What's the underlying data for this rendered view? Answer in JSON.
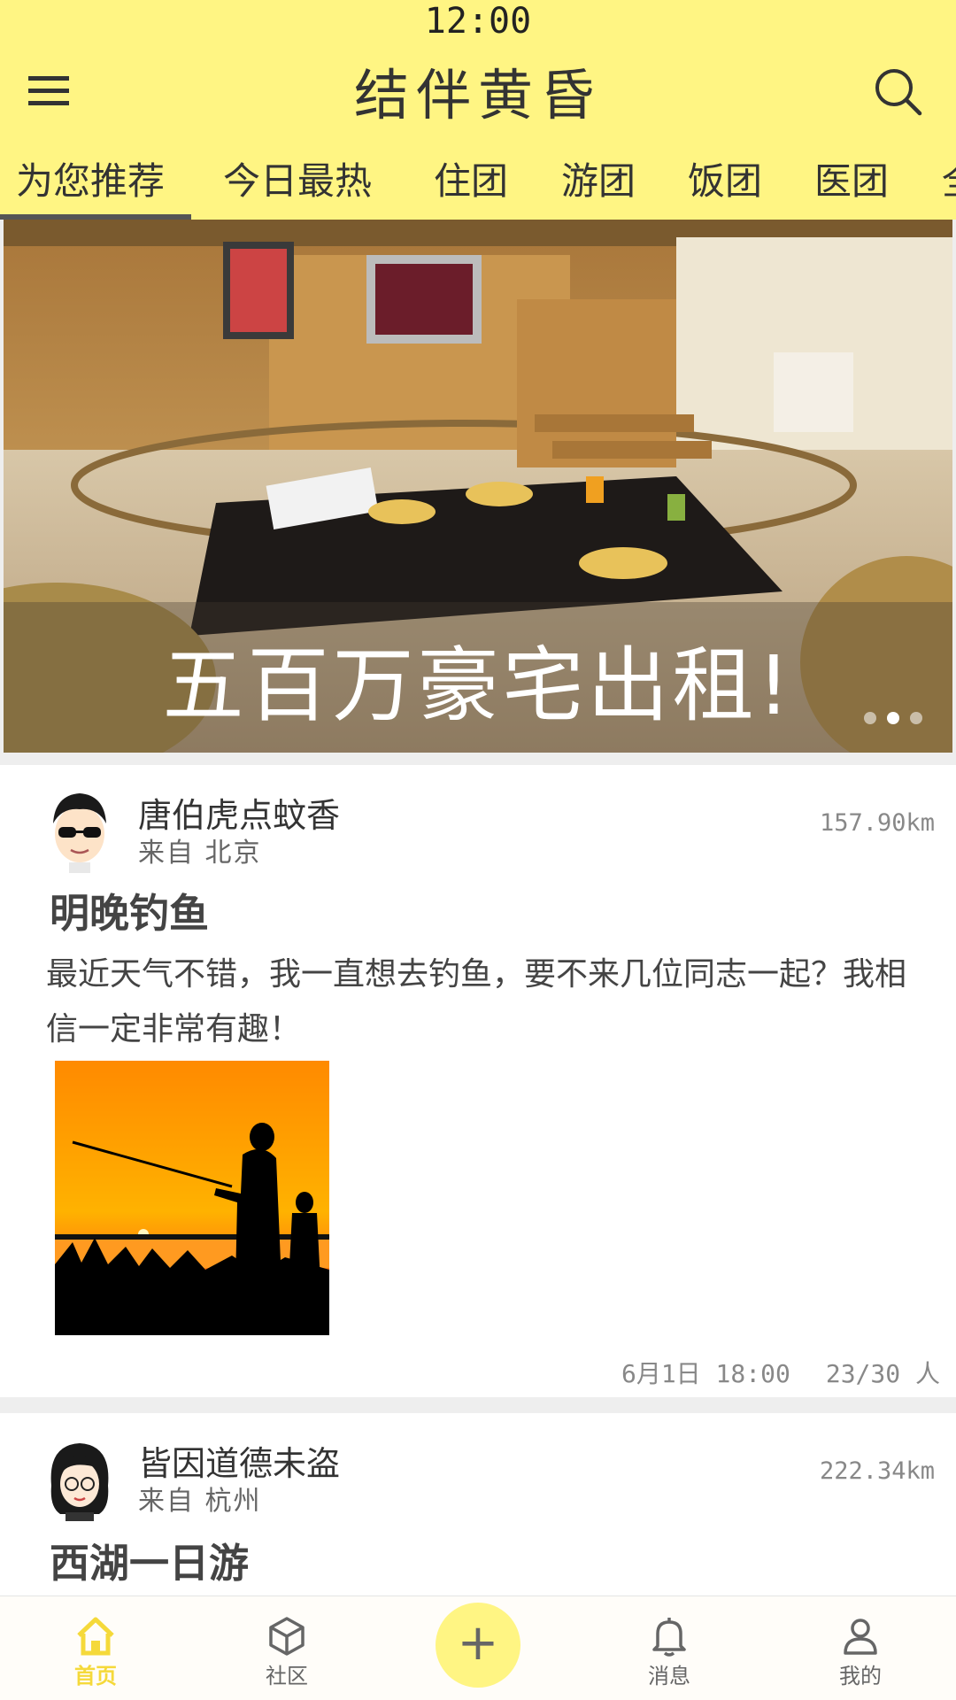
{
  "status_bar": {
    "time": "12:00"
  },
  "header": {
    "title": "结伴黄昏"
  },
  "tabs": [
    {
      "label": "为您推荐",
      "active": true
    },
    {
      "label": "今日最热"
    },
    {
      "label": "住团"
    },
    {
      "label": "游团"
    },
    {
      "label": "饭团"
    },
    {
      "label": "医团"
    },
    {
      "label": "全"
    }
  ],
  "banner": {
    "caption": "五百万豪宅出租!",
    "slide_count": 3,
    "active_slide": 2
  },
  "posts": [
    {
      "username": "唐伯虎点蚊香",
      "from": "来自 北京",
      "distance": "157.90km",
      "title": "明晚钓鱼",
      "body": "最近天气不错，我一直想去钓鱼，要不来几位同志一起？我相信一定非常有趣！",
      "date": "6月1日 18:00",
      "participants": "23/30 人"
    },
    {
      "username": "皆因道德未盗",
      "from": "来自 杭州",
      "distance": "222.34km",
      "title": "西湖一日游"
    }
  ],
  "bottom_nav": {
    "items": [
      {
        "label": "首页",
        "icon": "home-icon",
        "active": true
      },
      {
        "label": "社区",
        "icon": "cube-icon"
      },
      {
        "label": "消息",
        "icon": "bell-icon"
      },
      {
        "label": "我的",
        "icon": "user-icon"
      }
    ],
    "fab_label": "+"
  },
  "colors": {
    "accent": "#fff583",
    "active_nav": "#f5d93a"
  }
}
